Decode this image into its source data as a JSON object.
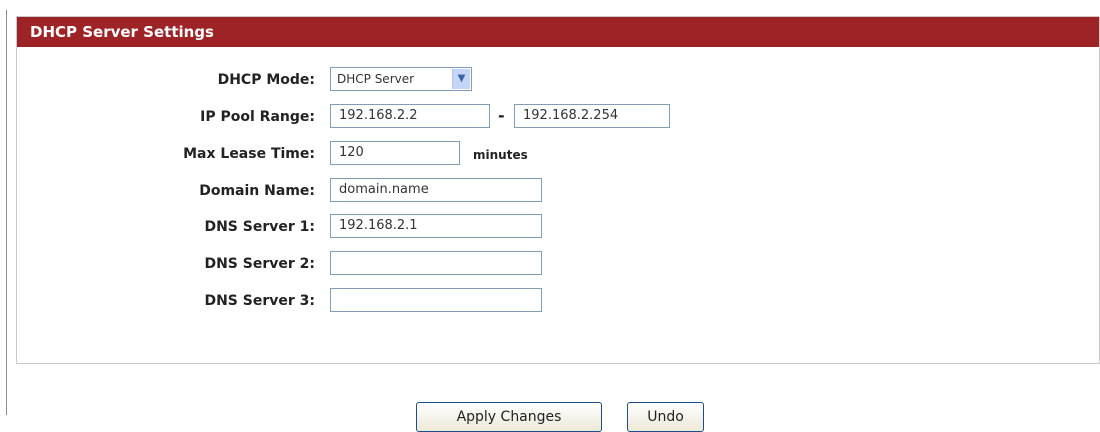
{
  "panel": {
    "title": "DHCP Server Settings"
  },
  "fields": {
    "dhcp_mode": {
      "label": "DHCP Mode:",
      "value": "DHCP Server"
    },
    "ip_pool_range": {
      "label": "IP Pool Range:",
      "start": "192.168.2.2",
      "separator": "-",
      "end": "192.168.2.254"
    },
    "max_lease_time": {
      "label": "Max Lease Time:",
      "value": "120",
      "unit": "minutes"
    },
    "domain_name": {
      "label": "Domain Name:",
      "value": "domain.name"
    },
    "dns_server_1": {
      "label": "DNS Server 1:",
      "value": "192.168.2.1"
    },
    "dns_server_2": {
      "label": "DNS Server 2:",
      "value": ""
    },
    "dns_server_3": {
      "label": "DNS Server 3:",
      "value": ""
    }
  },
  "buttons": {
    "apply": "Apply Changes",
    "undo": "Undo"
  },
  "colors": {
    "header_background": "#9e2327",
    "header_text": "#ffffff",
    "input_border": "#7f9db9"
  },
  "icons": {
    "dropdown": "chevron-down-icon"
  }
}
